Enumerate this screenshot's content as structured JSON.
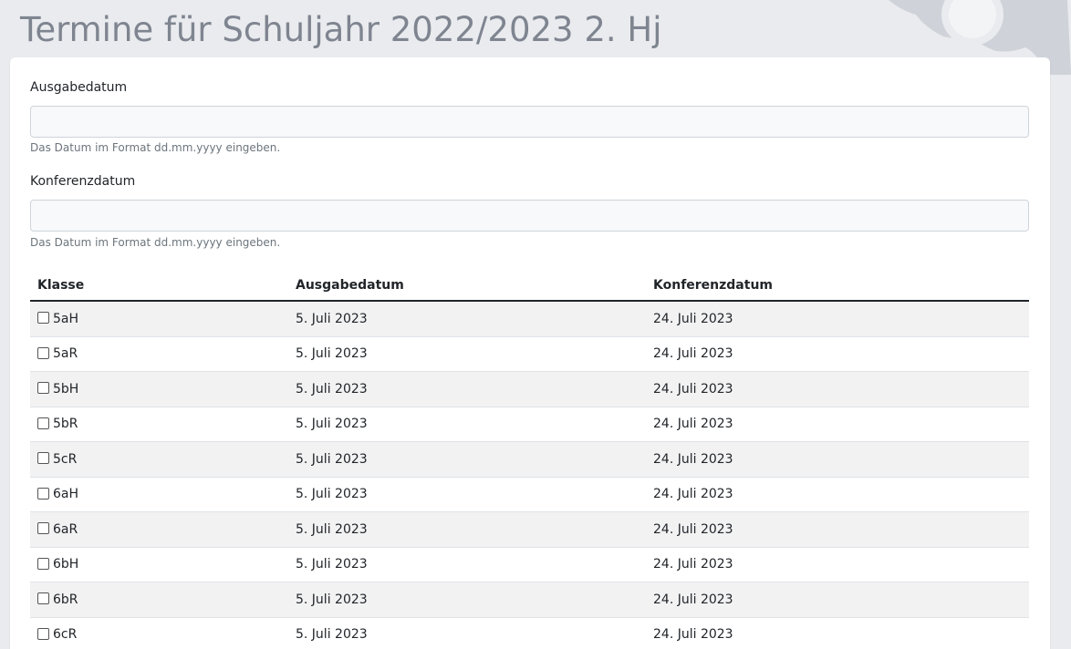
{
  "header": {
    "title": "Termine für Schuljahr 2022/2023 2. Hj"
  },
  "form": {
    "ausgabedatum": {
      "label": "Ausgabedatum",
      "value": "",
      "help": "Das Datum im Format dd.mm.yyyy eingeben."
    },
    "konferenzdatum": {
      "label": "Konferenzdatum",
      "value": "",
      "help": "Das Datum im Format dd.mm.yyyy eingeben."
    }
  },
  "table": {
    "headers": [
      "Klasse",
      "Ausgabedatum",
      "Konferenzdatum"
    ],
    "rows": [
      {
        "klasse": "5aH",
        "ausgabe": "5. Juli 2023",
        "konferenz": "24. Juli 2023",
        "checked": false
      },
      {
        "klasse": "5aR",
        "ausgabe": "5. Juli 2023",
        "konferenz": "24. Juli 2023",
        "checked": false
      },
      {
        "klasse": "5bH",
        "ausgabe": "5. Juli 2023",
        "konferenz": "24. Juli 2023",
        "checked": false
      },
      {
        "klasse": "5bR",
        "ausgabe": "5. Juli 2023",
        "konferenz": "24. Juli 2023",
        "checked": false
      },
      {
        "klasse": "5cR",
        "ausgabe": "5. Juli 2023",
        "konferenz": "24. Juli 2023",
        "checked": false
      },
      {
        "klasse": "6aH",
        "ausgabe": "5. Juli 2023",
        "konferenz": "24. Juli 2023",
        "checked": false
      },
      {
        "klasse": "6aR",
        "ausgabe": "5. Juli 2023",
        "konferenz": "24. Juli 2023",
        "checked": false
      },
      {
        "klasse": "6bH",
        "ausgabe": "5. Juli 2023",
        "konferenz": "24. Juli 2023",
        "checked": false
      },
      {
        "klasse": "6bR",
        "ausgabe": "5. Juli 2023",
        "konferenz": "24. Juli 2023",
        "checked": false
      },
      {
        "klasse": "6cR",
        "ausgabe": "5. Juli 2023",
        "konferenz": "24. Juli 2023",
        "checked": false
      }
    ]
  },
  "colors": {
    "title": "#7f8590",
    "background": "#e9ebee",
    "stripe": "#f2f2f3"
  },
  "icons": {
    "decoration": "gear-icon"
  }
}
